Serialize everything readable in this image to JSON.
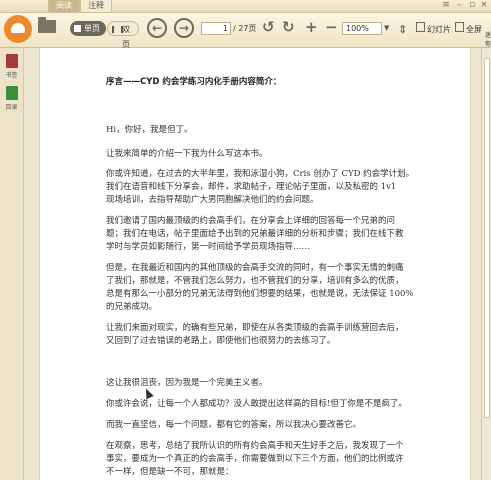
{
  "tabs": [
    {
      "label": "阅读"
    },
    {
      "label": "注释"
    }
  ],
  "toolbar": {
    "single_page": "单页",
    "double_page": "双页",
    "current_page": "1",
    "total_pages": "/ 27页",
    "zoom": "100%",
    "slideshow": "幻灯片",
    "fullscreen": "全屏",
    "mini_window": "迷你"
  },
  "sidebar": {
    "items": [
      {
        "label": "书签"
      },
      {
        "label": "目录"
      }
    ]
  },
  "document": {
    "title": "序言——CYD 约会学练习内化手册内容简介：",
    "paragraphs": [
      [
        "Hi，你好，我是但丁。"
      ],
      [
        "让我来简单的介绍一下我为什么写这本书。"
      ],
      [
        "你或许知道，在过去的大半年里，我和泳湿小狗，Cris 创办了 CYD 约会学计划。",
        "我们在语音和线下分享会，邮件，求助帖子，理论帖子里面，以及私密的 1v1",
        "现场培训，去指导帮助广大男同胞解决他们的约会问题。"
      ],
      [
        "我们邀请了国内最顶级的约会高手们，在分享会上详细的回答每一个兄弟的问",
        "题；我们在电话，帖子里面给予出到的兄弟最详细的分析和步骤；我们在线下教",
        "学时与学员如影随行，第一时间给予学员现场指导……"
      ],
      [
        "但是，在我最近和国内的其他顶级的会高手交流的同时，有一个事实无情的刺痛",
        "了我们，那就是，不管我们怎么努力，也不管我们的分享，培训有多么的优质，",
        "总是有那么一小部分的兄弟无法得到他们想要的结果，也就是说，无法保证 100%",
        "的兄弟成功。"
      ],
      [
        "让我们来面对现实，的确有些兄弟，即使在从各类顶级的会高手训练营回去后，",
        "又回到了过去错误的老路上，即使他们也很努力的去练习了。"
      ],
      [
        "这让我很沮丧，因为我是一个完美主义者。"
      ],
      [
        "你或许会说，让每一个人都成功？没人敢提出这样高的目标!但丁你是不是疯了。"
      ],
      [
        "而我一直坚信，每一个问题，都有它的答案，所以我决心要改善它。"
      ],
      [
        "在观察，思考，总结了我所认识的所有约会高手和天生好手之后，我发现了一个",
        "事实，要成为一个真正的约会高手，你需要做到以下三个方面，他们的比例或许",
        "不一样，但是缺一不可，那就是："
      ]
    ]
  },
  "colors": {
    "accent": "#e98a2c",
    "toolbar_bg": "#f5ecd3",
    "active_tab": "#c9b98a",
    "bookmark_red": "#a63a3a",
    "toc_green": "#3f8f3a"
  }
}
